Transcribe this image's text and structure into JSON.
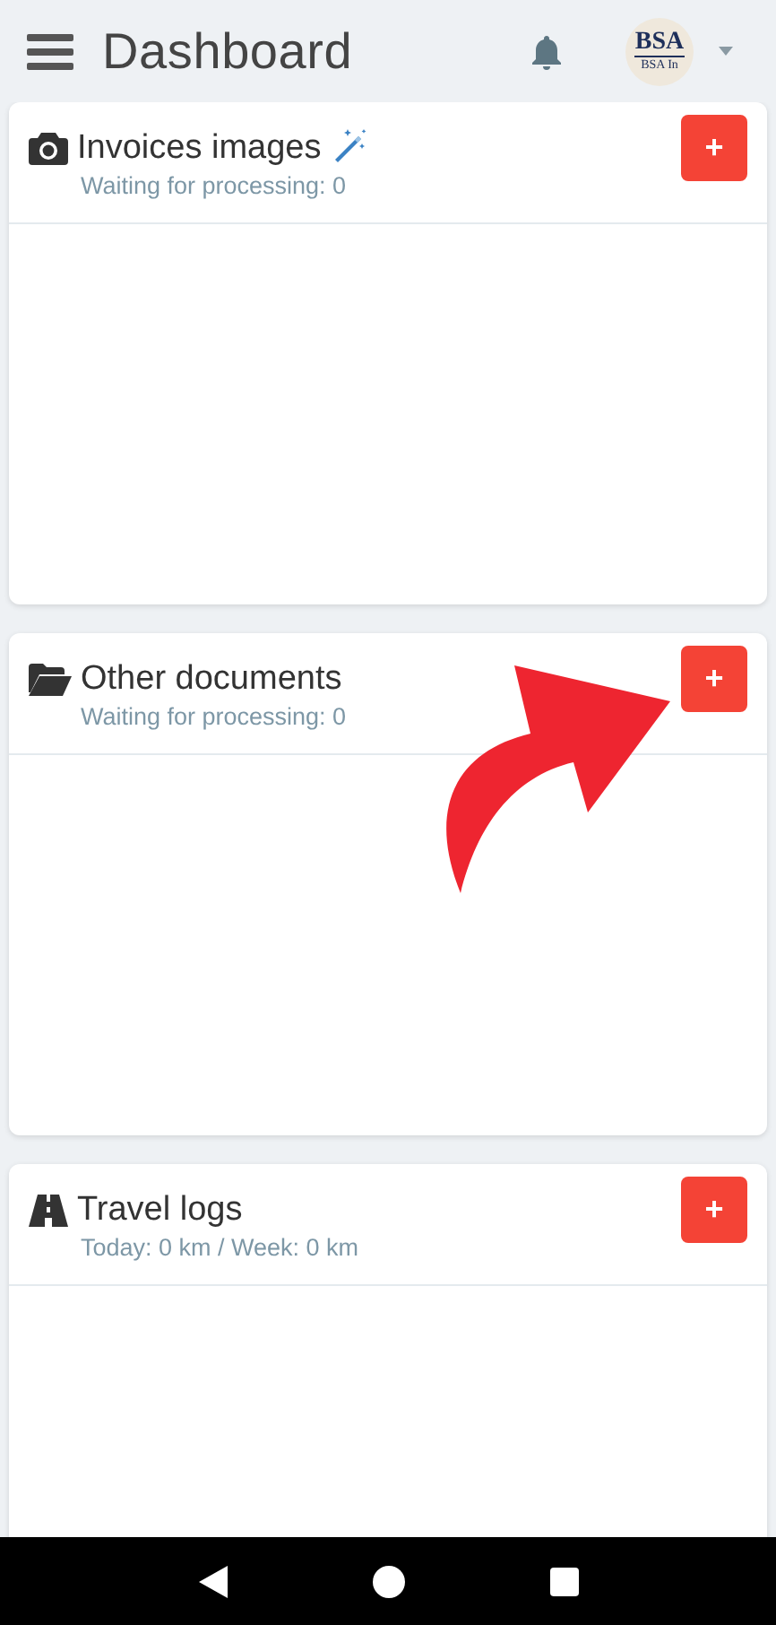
{
  "header": {
    "title": "Dashboard",
    "logo_text": "BSA",
    "logo_subtext": "BSA In"
  },
  "cards": [
    {
      "kind": "camera",
      "title": "Invoices images",
      "wand": true,
      "subtitle": "Waiting for processing: 0",
      "add_label": "+"
    },
    {
      "kind": "folder",
      "title": "Other documents",
      "wand": false,
      "subtitle": "Waiting for processing: 0",
      "add_label": "+"
    },
    {
      "kind": "road",
      "title": "Travel logs",
      "wand": false,
      "subtitle": "Today: 0 km / Week: 0 km",
      "add_label": "+"
    }
  ],
  "annotation": {
    "kind": "arrow"
  }
}
